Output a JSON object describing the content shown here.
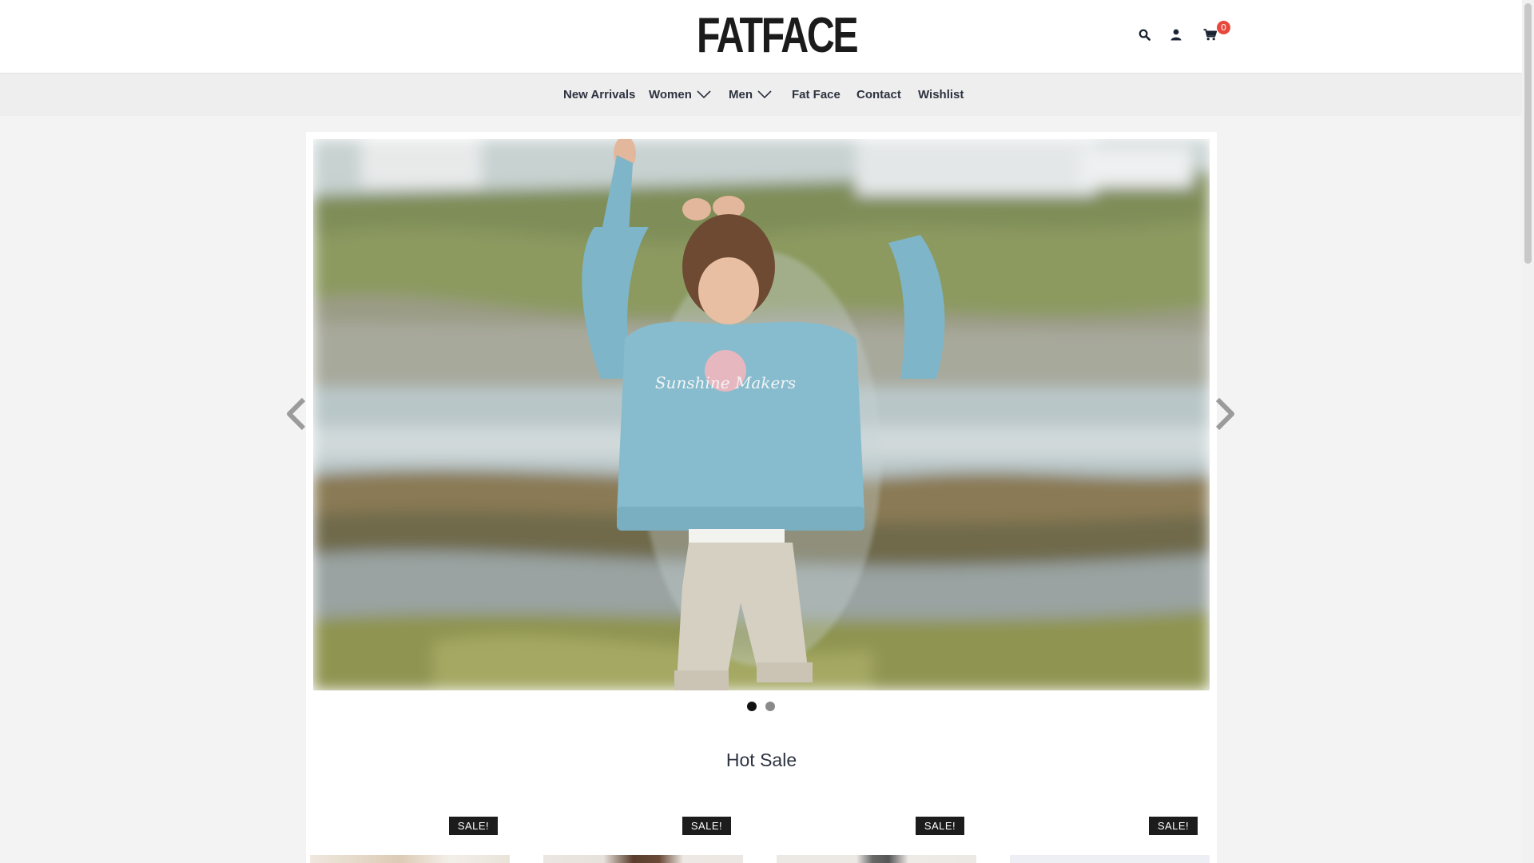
{
  "brand": {
    "name": "FATFACE"
  },
  "header": {
    "icons": [
      "search-icon",
      "user-icon",
      "cart-icon"
    ],
    "cart_count": "0"
  },
  "nav": {
    "items": [
      {
        "label": "New Arrivals",
        "has_dropdown": false
      },
      {
        "label": "Women",
        "has_dropdown": true
      },
      {
        "label": "Men",
        "has_dropdown": true
      },
      {
        "label": "Fat Face",
        "has_dropdown": false
      },
      {
        "label": "Contact",
        "has_dropdown": false
      },
      {
        "label": "Wishlist",
        "has_dropdown": false
      }
    ]
  },
  "slider": {
    "slides": 2,
    "active_slide": 1,
    "prev_icon": "chevron-left-icon",
    "next_icon": "chevron-right-icon",
    "shirt_print": "Sunshine Makers"
  },
  "hot_sale": {
    "title": "Hot Sale",
    "products": [
      {
        "badge": "SALE!"
      },
      {
        "badge": "SALE!"
      },
      {
        "badge": "SALE!"
      },
      {
        "badge": "SALE!"
      }
    ]
  },
  "colors": {
    "text_dark": "#2d3340",
    "nav_bg": "#eeeeee",
    "page_bg": "#f3f3f3",
    "badge_red": "#e8483c",
    "sale_badge": "#1c1c1c"
  }
}
